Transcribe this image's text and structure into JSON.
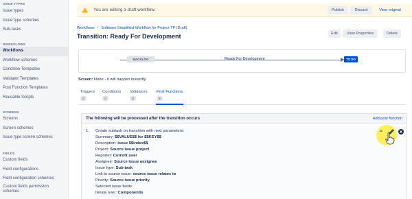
{
  "sidebar": {
    "sections": [
      {
        "title": "ISSUE TYPES",
        "items": [
          {
            "label": "Issue types"
          },
          {
            "label": "Issue type schemes"
          },
          {
            "label": "Sub-tasks"
          }
        ]
      },
      {
        "title": "WORKFLOWS",
        "items": [
          {
            "label": "Workflows",
            "active": true
          },
          {
            "label": "Workflow schemes"
          },
          {
            "label": "Condition Templates"
          },
          {
            "label": "Validator Templates"
          },
          {
            "label": "Post Function Templates"
          },
          {
            "label": "Reusable Scripts"
          }
        ]
      },
      {
        "title": "SCREENS",
        "items": [
          {
            "label": "Screens"
          },
          {
            "label": "Screen schemes"
          },
          {
            "label": "Issue type screen schemes"
          }
        ]
      },
      {
        "title": "FIELDS",
        "items": [
          {
            "label": "Custom fields"
          },
          {
            "label": "Field configurations"
          },
          {
            "label": "Field configuration schemes"
          },
          {
            "label": "Custom fields permission"
          },
          {
            "label": "schemes"
          }
        ]
      }
    ]
  },
  "banner": {
    "message": "You are editing a draft workflow.",
    "publish": "Publish",
    "discard": "Discard",
    "view_original": "View original"
  },
  "breadcrumb": {
    "root": "Workflows",
    "current": "Software Simplified Workflow for Project TP (Draft)"
  },
  "page_title": "Transition: Ready For Development",
  "header_buttons": {
    "edit": "Edit",
    "view_properties": "View Properties",
    "delete": "Delete"
  },
  "diagram": {
    "from": "BACKLOG",
    "transition": "Ready For Development",
    "to": "TO DO"
  },
  "screen": {
    "label": "Screen:",
    "value": "None - it will happen instantly"
  },
  "tabs": [
    {
      "label": "Triggers",
      "count": "0"
    },
    {
      "label": "Conditions",
      "count": "0"
    },
    {
      "label": "Validators",
      "count": "0"
    },
    {
      "label": "Post Functions",
      "count": "6",
      "active": true
    }
  ],
  "post_functions": {
    "header": "The following will be processed after the transition occurs",
    "add_label": "Add post function",
    "item_number": "1.",
    "lines": [
      {
        "label": "Create subtask on transition with next parameters:",
        "value": ""
      },
      {
        "label": "Summary: ",
        "value": "$$VALUE$$ for $$KEY$$"
      },
      {
        "label": "Description: ",
        "value": "issue $$index$$"
      },
      {
        "label": "Project: ",
        "value": "Source issue project"
      },
      {
        "label": "Reporter: ",
        "value": "Current user"
      },
      {
        "label": "Assignee: ",
        "value": "Source issue assignee"
      },
      {
        "label": "Issue type: ",
        "value": "Sub-task"
      },
      {
        "label": "Link to source issue: ",
        "value": "source issue relates to"
      },
      {
        "label": "Priority: ",
        "value": "Source issue priority"
      },
      {
        "label": "Selected issue fields:",
        "value": ""
      },
      {
        "label": "Iterate over: ",
        "value": "Component/s"
      }
    ]
  },
  "icons": {
    "warning": "warning-icon",
    "edit": "pencil-icon",
    "delete": "delete-icon",
    "move_up": "arrow-up-icon"
  }
}
